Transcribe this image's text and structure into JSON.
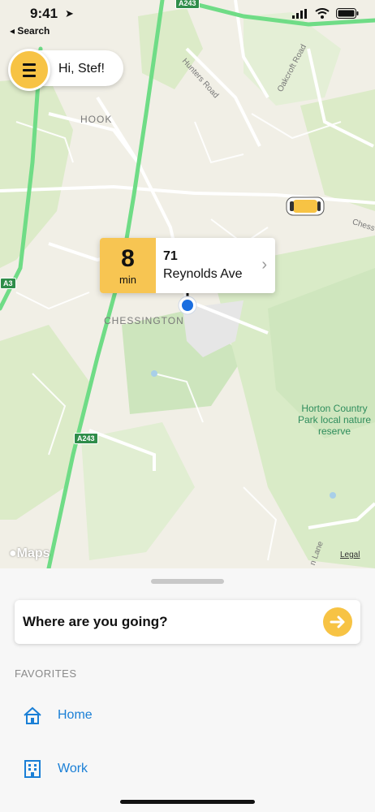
{
  "status_bar": {
    "time": "9:41",
    "back_label": "◂ Search"
  },
  "greeting": {
    "text": "Hi, Stef!"
  },
  "map": {
    "area_labels": [
      "HOOK",
      "CHESSINGTON"
    ],
    "road_labels": [
      "Hunters Road",
      "Oakcroft Road",
      "Chess",
      "n Lane"
    ],
    "road_shields": [
      "A243",
      "A3",
      "A243"
    ],
    "place_label": "Horton Country Park local nature reserve",
    "attribution": "Maps",
    "legal": "Legal"
  },
  "eta": {
    "minutes": "8",
    "unit": "min",
    "address_line1": "71",
    "address_line2": "Reynolds Ave"
  },
  "search": {
    "prompt": "Where are you going?"
  },
  "favorites": {
    "title": "FAVORITES",
    "items": [
      {
        "label": "Home",
        "icon": "home-icon"
      },
      {
        "label": "Work",
        "icon": "building-icon"
      }
    ]
  },
  "colors": {
    "accent_yellow": "#f7c344",
    "link_blue": "#1a7fd6",
    "road_green": "#6fdc86",
    "park_green": "#d9ecc9"
  }
}
